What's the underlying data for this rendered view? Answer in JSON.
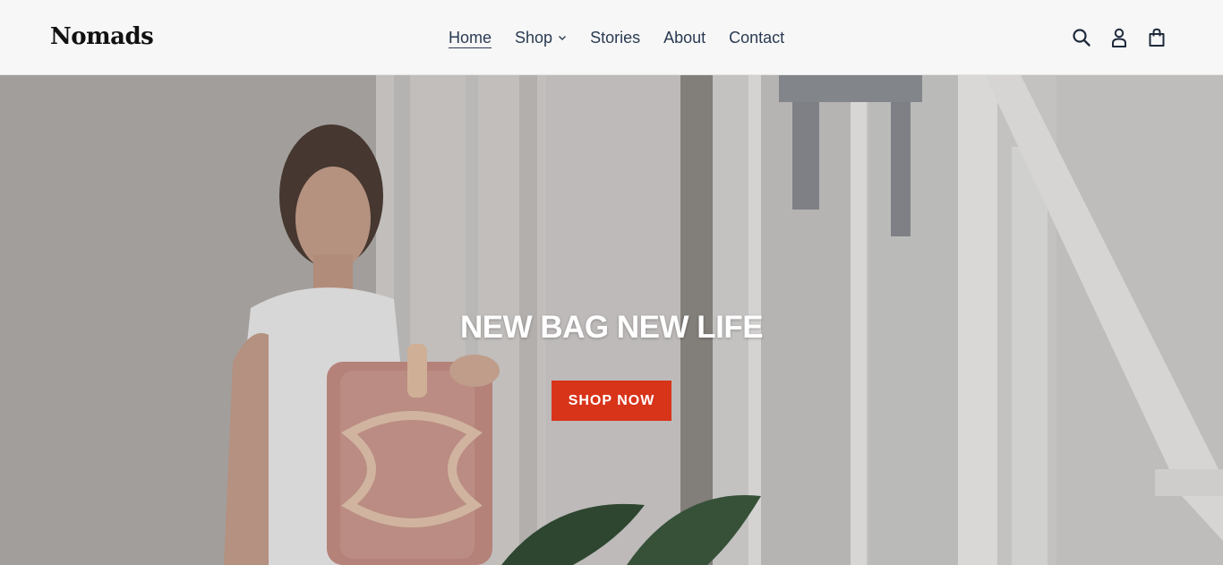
{
  "header": {
    "logo": "Nomads",
    "nav": [
      {
        "label": "Home",
        "active": true
      },
      {
        "label": "Shop",
        "has_dropdown": true
      },
      {
        "label": "Stories"
      },
      {
        "label": "About"
      },
      {
        "label": "Contact"
      }
    ],
    "icons": [
      "search-icon",
      "account-icon",
      "cart-icon"
    ]
  },
  "hero": {
    "title": "NEW BAG NEW LIFE",
    "button_label": "SHOP NOW"
  },
  "colors": {
    "accent": "#d8341a",
    "nav_text": "#2a3a52",
    "header_bg": "#f7f7f7"
  }
}
